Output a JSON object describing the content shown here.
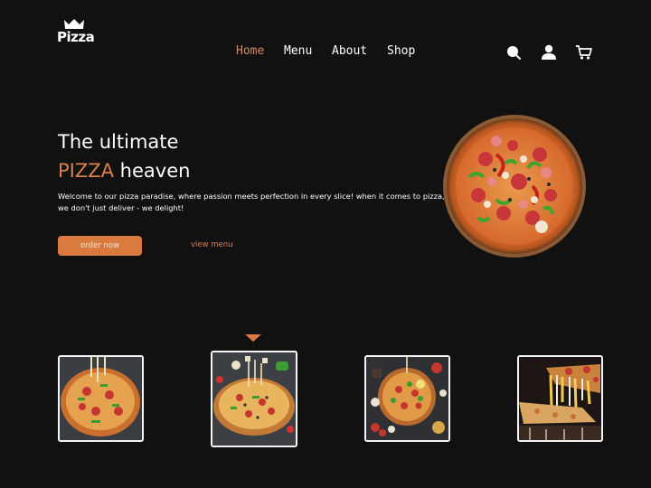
{
  "brand": {
    "logo_text": "Pizza",
    "logo_icon": "crown-icon"
  },
  "nav": {
    "items": [
      {
        "label": "Home",
        "active": true
      },
      {
        "label": "Menu",
        "active": false
      },
      {
        "label": "About",
        "active": false
      },
      {
        "label": "Shop",
        "active": false
      }
    ]
  },
  "header_icons": [
    "search-icon",
    "user-icon",
    "cart-icon"
  ],
  "hero": {
    "title_line1": "The ultimate",
    "title_accent": "PIZZA",
    "title_line2_rest": " heaven",
    "description": "Welcome to our pizza paradise, where passion meets perfection in every slice! when it comes to pizza, we don't just deliver - we delight!",
    "primary_button": "order now",
    "secondary_link": "view menu",
    "image": "pizza-hero-image"
  },
  "gallery": {
    "selected_index": 1,
    "thumbnails": [
      {
        "name": "pizza-thumbnail-pepperoni-veggie"
      },
      {
        "name": "pizza-thumbnail-cheese-pull"
      },
      {
        "name": "pizza-thumbnail-ingredients"
      },
      {
        "name": "pizza-thumbnail-slice-melting"
      }
    ]
  },
  "colors": {
    "background": "#111111",
    "accent": "#d97a3f",
    "nav_active": "#d08a68",
    "text": "#ffffff"
  }
}
